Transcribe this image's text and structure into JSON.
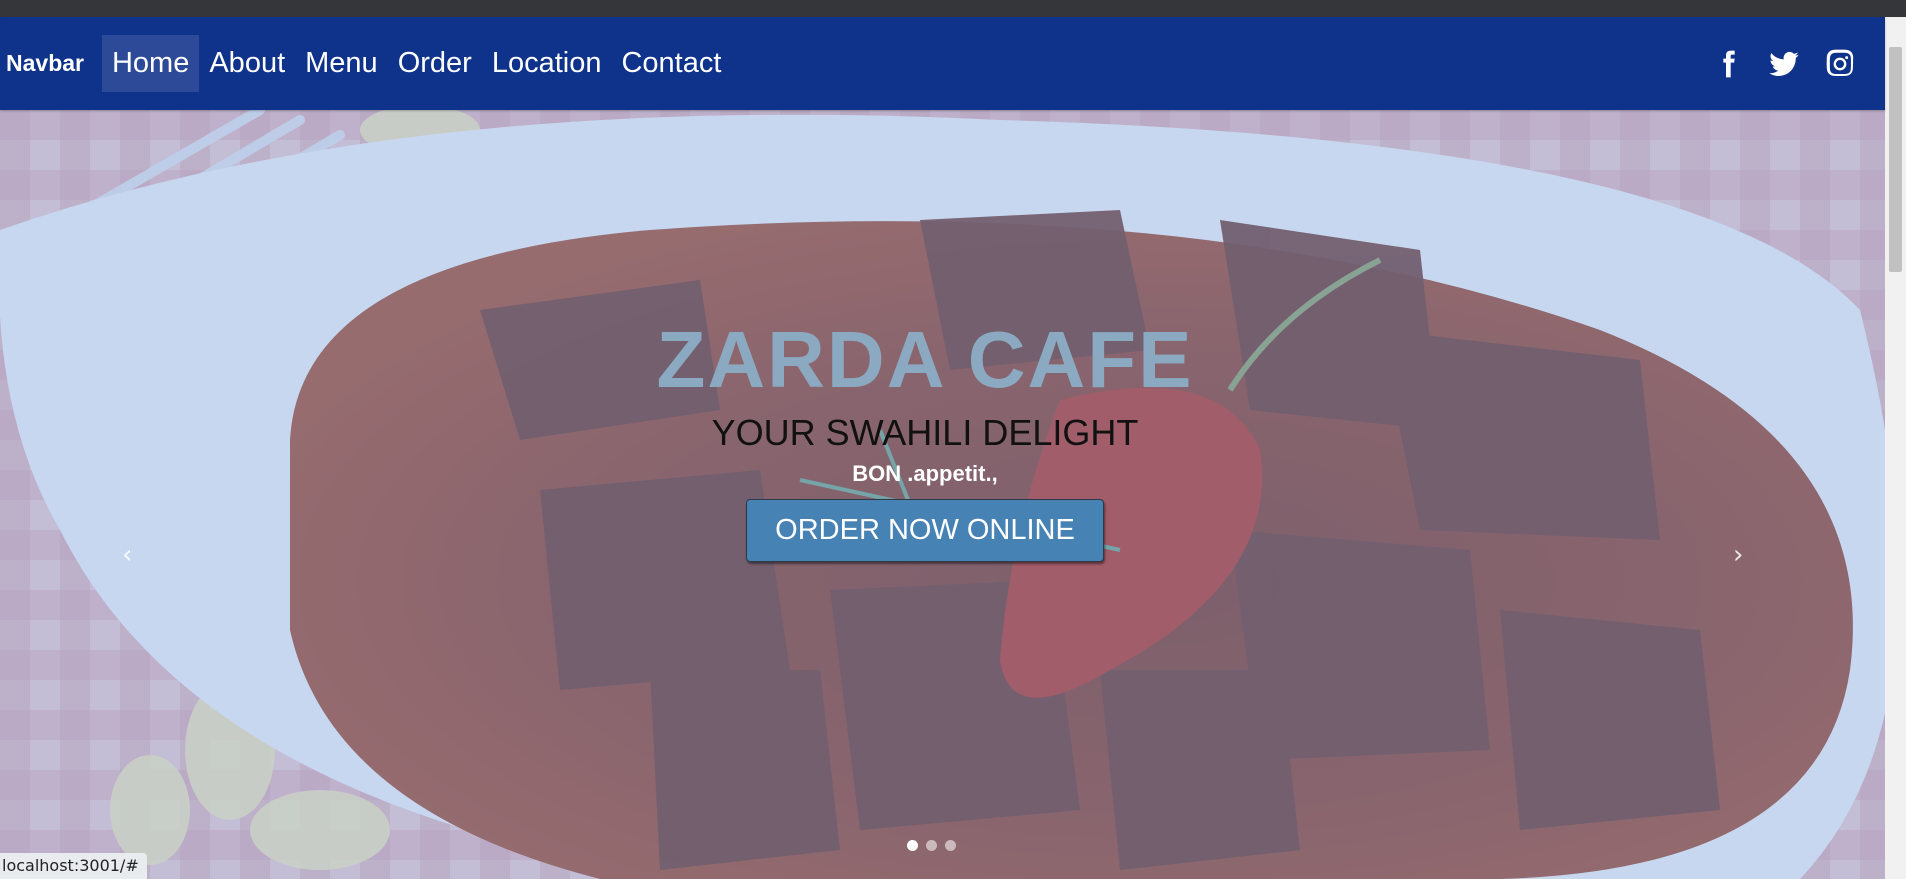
{
  "navbar": {
    "brand": "Navbar",
    "links": [
      {
        "label": "Home",
        "active": true
      },
      {
        "label": "About"
      },
      {
        "label": "Menu"
      },
      {
        "label": "Order"
      },
      {
        "label": "Location"
      },
      {
        "label": "Contact"
      }
    ],
    "socials": [
      "facebook-icon",
      "twitter-icon",
      "instagram-icon"
    ],
    "background_color": "#0f328a"
  },
  "hero": {
    "title": "ZARDA CAFE",
    "subtitle": "YOUR SWAHILI DELIGHT",
    "tagline": "BON .appetit.,",
    "button_label": "ORDER NOW ONLINE",
    "prev_arrow": "‹",
    "next_arrow": "›",
    "slides": 3,
    "active_slide": 1,
    "button_color": "#4682b4",
    "title_color": "#8ba9c0"
  },
  "status_bar": {
    "url": "localhost:3001/#"
  }
}
